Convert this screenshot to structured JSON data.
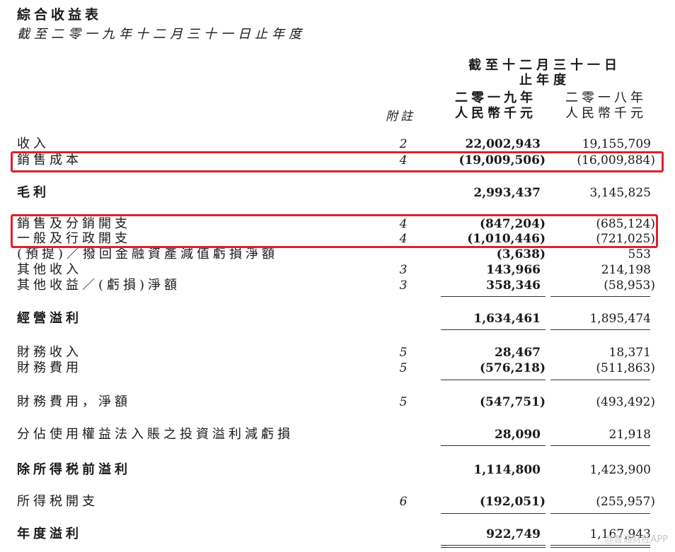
{
  "title": "綜合收益表",
  "subtitle": "截至二零一九年十二月三十一日止年度",
  "header": {
    "period_line1": "截至十二月三十一日",
    "period_line2": "止年度",
    "note_label": "附註",
    "col_current_year": "二零一九年",
    "col_current_unit": "人民幣千元",
    "col_prior_year": "二零一八年",
    "col_prior_unit": "人民幣千元"
  },
  "rows": [
    {
      "label": "收入",
      "note": "2",
      "current": "22,002,943",
      "prior": "19,155,709"
    },
    {
      "label": "銷售成本",
      "note": "4",
      "current": "(19,009,506)",
      "prior": "(16,009,884)"
    },
    {
      "label": "毛利",
      "note": "",
      "current": "2,993,437",
      "prior": "3,145,825"
    },
    {
      "label": "銷售及分銷開支",
      "note": "4",
      "current": "(847,204)",
      "prior": "(685,124)"
    },
    {
      "label": "一般及行政開支",
      "note": "4",
      "current": "(1,010,446)",
      "prior": "(721,025)"
    },
    {
      "label": "(預提)／撥回金融資產減值虧損淨額",
      "note": "",
      "current": "(3,638)",
      "prior": "553"
    },
    {
      "label": "其他收入",
      "note": "3",
      "current": "143,966",
      "prior": "214,198"
    },
    {
      "label": "其他收益／(虧損)淨額",
      "note": "3",
      "current": "358,346",
      "prior": "(58,953)"
    },
    {
      "label": "經營溢利",
      "note": "",
      "current": "1,634,461",
      "prior": "1,895,474"
    },
    {
      "label": "財務收入",
      "note": "5",
      "current": "28,467",
      "prior": "18,371"
    },
    {
      "label": "財務費用",
      "note": "5",
      "current": "(576,218)",
      "prior": "(511,863)"
    },
    {
      "label": "財務費用，淨額",
      "note": "5",
      "current": "(547,751)",
      "prior": "(493,492)"
    },
    {
      "label": "分佔使用權益法入賬之投資溢利減虧損",
      "note": "",
      "current": "28,090",
      "prior": "21,918"
    },
    {
      "label": "除所得税前溢利",
      "note": "",
      "current": "1,114,800",
      "prior": "1,423,900"
    },
    {
      "label": "所得税開支",
      "note": "6",
      "current": "(192,051)",
      "prior": "(255,957)"
    },
    {
      "label": "年度溢利",
      "note": "",
      "current": "922,749",
      "prior": "1,167,943"
    }
  ],
  "watermark": "@智通财经APP",
  "highlight_color": "#e0202a"
}
